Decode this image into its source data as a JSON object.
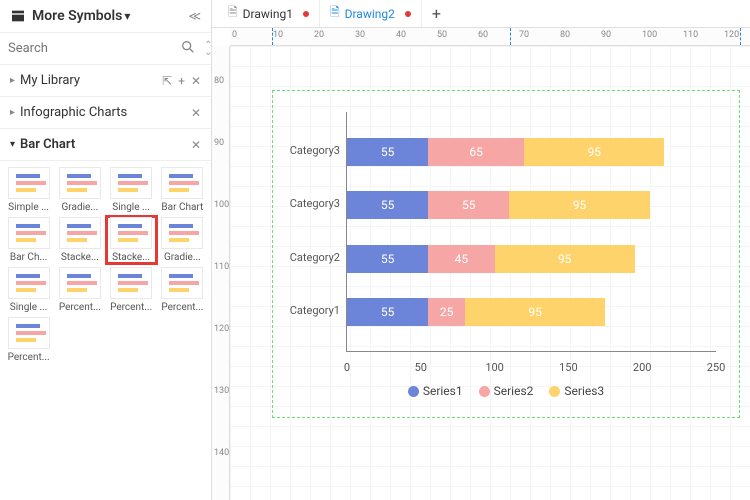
{
  "header": {
    "title": "More Symbols"
  },
  "search": {
    "placeholder": "Search"
  },
  "sections": {
    "mylib": {
      "label": "My Library"
    },
    "info": {
      "label": "Infographic Charts"
    },
    "bar": {
      "label": "Bar Chart"
    }
  },
  "thumbs": [
    {
      "label": "Simple ..."
    },
    {
      "label": "Gradie..."
    },
    {
      "label": "Single ..."
    },
    {
      "label": "Bar Chart"
    },
    {
      "label": "Bar Ch..."
    },
    {
      "label": "Stacke..."
    },
    {
      "label": "Stacke..."
    },
    {
      "label": "Gradie..."
    },
    {
      "label": "Single ..."
    },
    {
      "label": "Percent..."
    },
    {
      "label": "Percent..."
    },
    {
      "label": "Percent..."
    },
    {
      "label": "Percent..."
    }
  ],
  "tabs": [
    {
      "label": "Drawing1"
    },
    {
      "label": "Drawing2"
    }
  ],
  "ruler_h": [
    "0",
    "10",
    "20",
    "30",
    "40",
    "50",
    "60",
    "70",
    "80",
    "90",
    "100",
    "110",
    "120"
  ],
  "ruler_v": [
    "80",
    "90",
    "100",
    "110",
    "120",
    "130",
    "140"
  ],
  "chart_data": {
    "type": "bar",
    "orientation": "horizontal-stacked",
    "categories": [
      "Category1",
      "Category2",
      "Category3",
      "Category3"
    ],
    "series": [
      {
        "name": "Series1",
        "values": [
          55,
          55,
          55,
          55
        ],
        "color": "#6d85d8"
      },
      {
        "name": "Series2",
        "values": [
          25,
          45,
          55,
          65
        ],
        "color": "#f7a6a6"
      },
      {
        "name": "Series3",
        "values": [
          95,
          95,
          95,
          95
        ],
        "color": "#ffd36b"
      }
    ],
    "xticks": [
      0,
      50,
      100,
      150,
      200,
      250
    ],
    "xlabel": "",
    "ylabel": "",
    "xlim": [
      0,
      250
    ]
  }
}
